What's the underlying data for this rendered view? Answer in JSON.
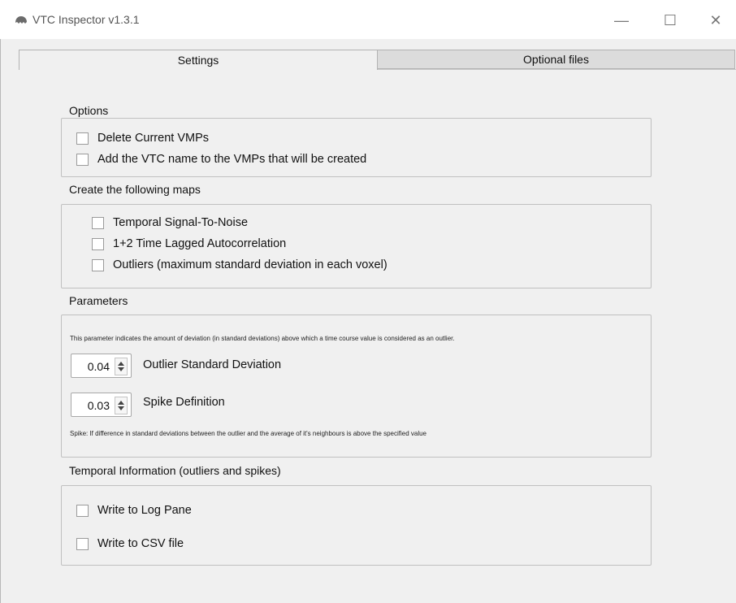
{
  "window": {
    "title": "VTC Inspector v1.3.1",
    "app_icon": "brain-icon",
    "controls": {
      "minimize": "—",
      "maximize": "☐",
      "close": "✕"
    }
  },
  "tabs": [
    {
      "label": "Settings",
      "active": true
    },
    {
      "label": "Optional files",
      "active": false
    }
  ],
  "options": {
    "label": "Options",
    "items": [
      {
        "label": "Delete Current VMPs",
        "checked": false
      },
      {
        "label": "Add the VTC name to the VMPs that will be created",
        "checked": false
      }
    ]
  },
  "maps": {
    "label": "Create the following maps",
    "items": [
      {
        "label": "Temporal Signal-To-Noise",
        "checked": false
      },
      {
        "label": "1+2 Time Lagged Autocorrelation",
        "checked": false
      },
      {
        "label": "Outliers (maximum standard deviation in each voxel)",
        "checked": false
      }
    ]
  },
  "parameters": {
    "label": "Parameters",
    "note": "This parameter indicates the amount of deviation (in standard deviations) above which a time course value is considered as an outlier.",
    "outlier": {
      "value": "0.04",
      "label": "Outlier Standard Deviation"
    },
    "spike": {
      "value": "0.03",
      "label": "Spike Definition"
    },
    "spike_note": "Spike: If difference in standard deviations between the outlier and the average of it's neighbours is above the specified value"
  },
  "temporal": {
    "label": "Temporal Information (outliers and spikes)",
    "items": [
      {
        "label": "Write to Log Pane",
        "checked": false
      },
      {
        "label": "Write to CSV file",
        "checked": false
      }
    ]
  }
}
